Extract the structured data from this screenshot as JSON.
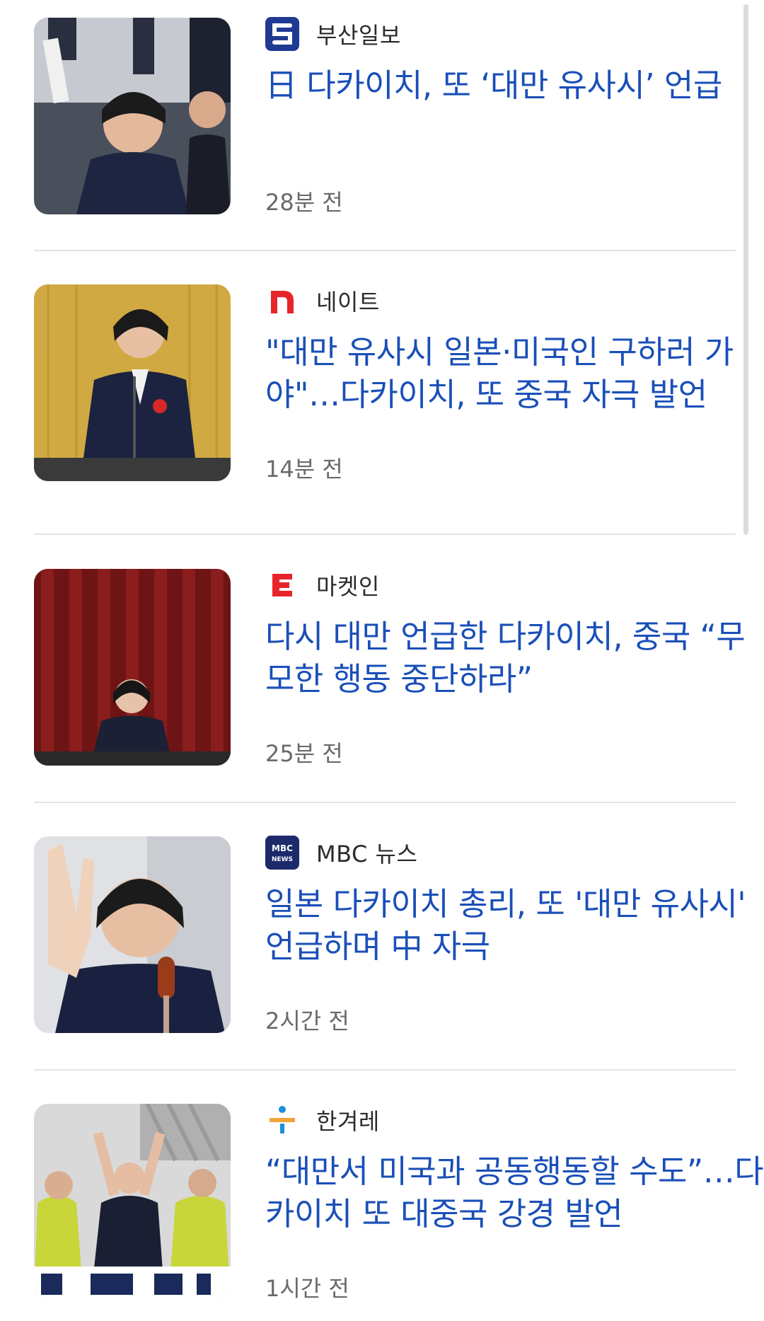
{
  "articles": [
    {
      "publisher": "부산일보",
      "publisher_logo": "busan-ilbo-logo",
      "logo_color": "#1f3a93",
      "headline": "日 다카이치, 또 ‘대만 유사시’ 언급",
      "time": "28분 전"
    },
    {
      "publisher": "네이트",
      "publisher_logo": "nate-logo",
      "logo_color": "#e8242b",
      "headline": "\"대만 유사시 일본·미국인 구하러 가야\"…다카이치, 또 중국 자극 발언",
      "time": "14분 전"
    },
    {
      "publisher": "마켓인",
      "publisher_logo": "marketin-logo",
      "logo_color": "#e8242b",
      "headline": "다시 대만 언급한 다카이치, 중국 “무모한 행동 중단하라”",
      "time": "25분 전"
    },
    {
      "publisher": "MBC 뉴스",
      "publisher_logo": "mbc-news-logo",
      "logo_color": "#1c2a6b",
      "headline": "일본 다카이치 총리, 또 '대만 유사시' 언급하며 中 자극",
      "time": "2시간 전"
    },
    {
      "publisher": "한겨레",
      "publisher_logo": "hankyoreh-logo",
      "logo_color": "#1e8fd6",
      "headline": "“대만서 미국과 공동행동할 수도”…다카이치 또 대중국 강경 발언",
      "time": "1시간 전"
    }
  ],
  "colors": {
    "headline": "#1a4fb8",
    "publisher": "#2b2b2b",
    "time": "#6a6a6a",
    "divider": "#e3e3e3"
  }
}
